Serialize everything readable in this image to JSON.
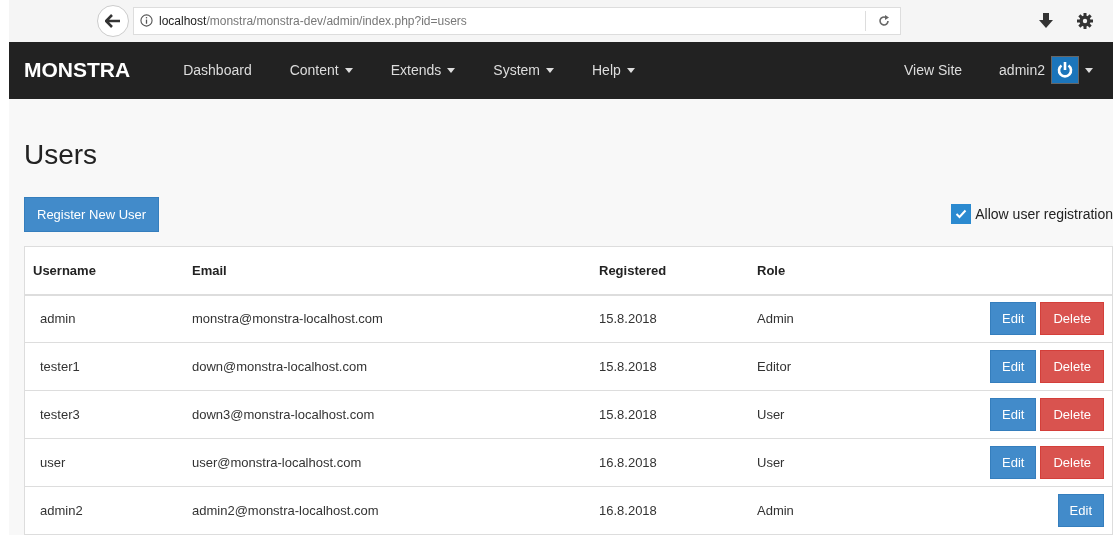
{
  "browser": {
    "url_host": "localhost",
    "url_path": "/monstra/monstra-dev/admin/index.php?id=users"
  },
  "navbar": {
    "brand": "MONSTRA",
    "items": [
      {
        "label": "Dashboard",
        "dropdown": false
      },
      {
        "label": "Content",
        "dropdown": true
      },
      {
        "label": "Extends",
        "dropdown": true
      },
      {
        "label": "System",
        "dropdown": true
      },
      {
        "label": "Help",
        "dropdown": true
      }
    ],
    "view_site": "View Site",
    "user": "admin2"
  },
  "page": {
    "title": "Users",
    "register_button": "Register New User",
    "allow_registration": {
      "label": "Allow user registration",
      "checked": true
    }
  },
  "table": {
    "columns": [
      "Username",
      "Email",
      "Registered",
      "Role"
    ],
    "rows": [
      {
        "cells": [
          "admin",
          "monstra@monstra-localhost.com",
          "15.8.2018",
          "Admin"
        ],
        "actions": [
          {
            "kind": "edit",
            "label": "Edit"
          },
          {
            "kind": "delete",
            "label": "Delete"
          }
        ]
      },
      {
        "cells": [
          "tester1",
          "down@monstra-localhost.com",
          "15.8.2018",
          "Editor"
        ],
        "actions": [
          {
            "kind": "edit",
            "label": "Edit"
          },
          {
            "kind": "delete",
            "label": "Delete"
          }
        ]
      },
      {
        "cells": [
          "tester3",
          "down3@monstra-localhost.com",
          "15.8.2018",
          "User"
        ],
        "actions": [
          {
            "kind": "edit",
            "label": "Edit"
          },
          {
            "kind": "delete",
            "label": "Delete"
          }
        ]
      },
      {
        "cells": [
          "user",
          "user@monstra-localhost.com",
          "16.8.2018",
          "User"
        ],
        "actions": [
          {
            "kind": "edit",
            "label": "Edit"
          },
          {
            "kind": "delete",
            "label": "Delete"
          }
        ]
      },
      {
        "cells": [
          "admin2",
          "admin2@monstra-localhost.com",
          "16.8.2018",
          "Admin"
        ],
        "actions": [
          {
            "kind": "edit",
            "label": "Edit"
          }
        ]
      }
    ]
  }
}
